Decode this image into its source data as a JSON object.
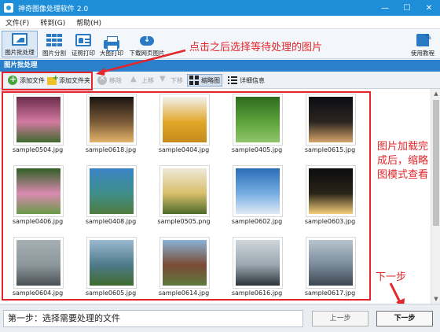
{
  "window": {
    "title": "神奇图像处理软件 2.0",
    "controls": [
      "—",
      "☐",
      "✕"
    ]
  },
  "menu": [
    "文件(F)",
    "转到(G)",
    "帮助(H)"
  ],
  "ribbon": {
    "buttons": [
      {
        "label": "图片批处理",
        "icon": "picture-icon",
        "active": true
      },
      {
        "label": "图片分割",
        "icon": "grid-icon"
      },
      {
        "label": "证照打印",
        "icon": "id-card-icon"
      },
      {
        "label": "大图打印",
        "icon": "printer-icon"
      },
      {
        "label": "下载网页图片",
        "icon": "cloud-download-icon"
      }
    ],
    "tutorial_label": "使用教程"
  },
  "section": {
    "title": "图片批处理"
  },
  "toolbar": {
    "add_file": "添加文件",
    "add_folder": "添加文件夹",
    "remove": "移除",
    "move_up": "上移",
    "move_down": "下移",
    "thumbnails": "缩略图",
    "details": "详细信息"
  },
  "files": [
    {
      "name": "sample0504.jpg",
      "colors": [
        "#6b2c4a",
        "#d27aa0",
        "#3f6a2e"
      ]
    },
    {
      "name": "sample0618.jpg",
      "colors": [
        "#1a1410",
        "#7a5a38",
        "#e3b46a"
      ]
    },
    {
      "name": "sample0404.jpg",
      "colors": [
        "#f2f1ee",
        "#e2a82a",
        "#c48a1c"
      ]
    },
    {
      "name": "sample0405.jpg",
      "colors": [
        "#2d6a1e",
        "#5ea33c",
        "#8fc46a"
      ]
    },
    {
      "name": "sample0615.jpg",
      "colors": [
        "#0c0d14",
        "#2b2520",
        "#d6a46a"
      ]
    },
    {
      "name": "sample0406.jpg",
      "colors": [
        "#2f5f24",
        "#d98ab0",
        "#6a9a48"
      ]
    },
    {
      "name": "sample0408.jpg",
      "colors": [
        "#3a83c4",
        "#3f8f8a",
        "#4f7a3e"
      ]
    },
    {
      "name": "sample0505.png",
      "colors": [
        "#efe8d8",
        "#d7bf6a",
        "#4e6a2a"
      ]
    },
    {
      "name": "sample0602.jpg",
      "colors": [
        "#2b6db6",
        "#76aee2",
        "#dfe9f4"
      ]
    },
    {
      "name": "sample0603.jpg",
      "colors": [
        "#0a0c10",
        "#2a2418",
        "#f5d07a"
      ]
    },
    {
      "name": "sample0604.jpg",
      "colors": [
        "#a6b0b4",
        "#8c979c",
        "#4a5054"
      ]
    },
    {
      "name": "sample0605.jpg",
      "colors": [
        "#9ab9d0",
        "#4e7a8a",
        "#3f6b2c"
      ]
    },
    {
      "name": "sample0614.jpg",
      "colors": [
        "#8ab4d8",
        "#7a4a34",
        "#5f7a3e"
      ]
    },
    {
      "name": "sample0616.jpg",
      "colors": [
        "#cfd6dc",
        "#9aa6ae",
        "#2c343a"
      ]
    },
    {
      "name": "sample0617.jpg",
      "colors": [
        "#b6c4cf",
        "#7a8a9a",
        "#3c4650"
      ]
    }
  ],
  "annotations": {
    "click_hint": "点击之后选择等待处理的图片",
    "thumb_hint": [
      "图片加载完",
      "成后，缩略",
      "图模式查看"
    ],
    "next_hint": "下一步",
    "color": "#e3262b"
  },
  "footer": {
    "step_text": "第一步：选择需要处理的文件",
    "prev": "上一步",
    "next": "下一步"
  }
}
